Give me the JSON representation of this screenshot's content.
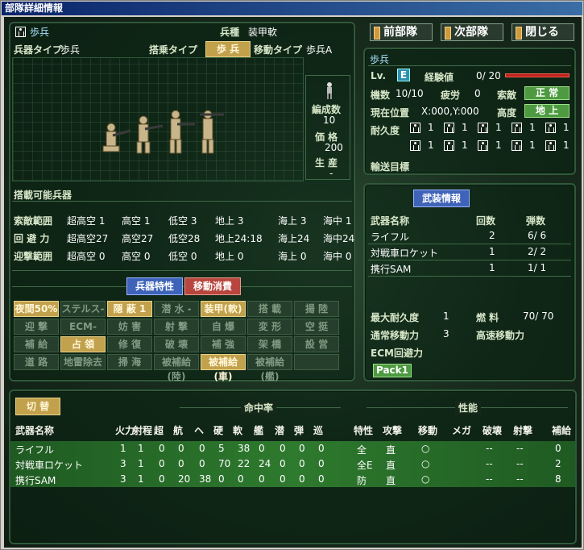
{
  "window": {
    "title": "部隊詳細情報"
  },
  "top_buttons": {
    "prev": "前部隊",
    "next": "次部隊",
    "close": "閉じる"
  },
  "unit": {
    "name": "歩兵",
    "type_label": "兵種",
    "type_value": "装甲軟",
    "weapon_type_label": "兵器タイプ",
    "weapon_type_value": "歩兵",
    "ride_label": "搭乗タイプ",
    "ride_value": "歩 兵",
    "move_type_label": "移動タイプ",
    "move_type_value": "歩兵A",
    "formation_label": "編成数",
    "formation_value": "10",
    "price_label": "価 格",
    "price_value": "200",
    "production_label": "生 産",
    "production_value": "-",
    "carry_label": "搭載可能兵器"
  },
  "ranges": {
    "rows": [
      {
        "label": "索敵範囲",
        "cols": [
          "超高空 1",
          "高空 1",
          "低空 3",
          "地上 3",
          "海上 3",
          "海中 1"
        ]
      },
      {
        "label": "回 避 力",
        "cols": [
          "超高空27",
          "高空27",
          "低空28",
          "地上24:18",
          "海上24",
          "海中24"
        ]
      },
      {
        "label": "迎撃範囲",
        "cols": [
          "超高空 0",
          "高空 0",
          "低空 0",
          "地上 0",
          "海上 0",
          "海中 0"
        ]
      }
    ]
  },
  "tabs": {
    "traits": "兵器特性",
    "move_cost": "移動消費"
  },
  "traits_grid": [
    [
      "夜間50%",
      "ステルス-",
      "隠 蔽 1",
      "潜 水 -",
      "装甲(軟)",
      "搭 載",
      "揚 陸"
    ],
    [
      "迎 撃",
      "ECM-",
      "妨 害",
      "射 撃",
      "自 爆",
      "変 形",
      "空 挺"
    ],
    [
      "補 給",
      "占 領",
      "修 復",
      "破 壊",
      "補 強",
      "架 橋",
      "設 営"
    ],
    [
      "道 路",
      "地雷除去",
      "掃 海",
      "被補給(陸)",
      "被補給(車)",
      "被補給(艦)",
      ""
    ]
  ],
  "traits_on": {
    "夜間50%": true,
    "隠 蔽 1": true,
    "装甲(軟)": true,
    "占 領": true,
    "被補給(車)": true
  },
  "status": {
    "name": "歩兵",
    "lv_label": "Lv.",
    "lv_value": "E",
    "exp_label": "経験値",
    "exp_value": "0/ 20",
    "unit_num_label": "機数",
    "unit_num_value": "10/10",
    "fatigue_label": "疲労",
    "fatigue_value": "0",
    "search_label": "索敵",
    "search_value": "正 常",
    "pos_label": "現在位置",
    "pos_value": "X:000,Y:000",
    "alt_label": "高度",
    "alt_value": "地 上",
    "dur_label": "耐久度",
    "dur_cells": [
      "1",
      "1",
      "1",
      "1",
      "1",
      "1",
      "1",
      "1",
      "1",
      "1"
    ],
    "transport_label": "輸送目標"
  },
  "armament": {
    "title": "武装情報",
    "headers": {
      "name": "武器名称",
      "count": "回数",
      "ammo": "弾数"
    },
    "rows": [
      {
        "name": "ライフル",
        "count": "2",
        "ammo": "6/ 6"
      },
      {
        "name": "対戦車ロケット",
        "count": "1",
        "ammo": "2/ 2"
      },
      {
        "name": "携行SAM",
        "count": "1",
        "ammo": "1/ 1"
      }
    ],
    "max_dur_label": "最大耐久度",
    "max_dur_value": "1",
    "fuel_label": "燃 料",
    "fuel_value": "70/ 70",
    "normal_move_label": "通常移動力",
    "normal_move_value": "3",
    "fast_move_label": "高速移動力",
    "ecm_label": "ECM回避力",
    "pack_label": "Pack1"
  },
  "weapons_table": {
    "switch_label": "切 替",
    "hit_group": "命中率",
    "perf_group": "性能",
    "headers": [
      "武器名称",
      "火力",
      "射程",
      "超",
      "航",
      "ヘ",
      "硬",
      "軟",
      "艦",
      "潜",
      "弾",
      "巡",
      "特性",
      "攻撃",
      "移動",
      "メガ",
      "破壊",
      "射撃",
      "補給"
    ],
    "rows": [
      [
        "ライフル",
        "1",
        "1",
        "0",
        "0",
        "0",
        "5",
        "38",
        "0",
        "0",
        "0",
        "0",
        "全",
        "直",
        "○",
        "",
        "--",
        "--",
        "0"
      ],
      [
        "対戦車ロケット",
        "3",
        "1",
        "0",
        "0",
        "0",
        "70",
        "22",
        "24",
        "0",
        "0",
        "0",
        "全E",
        "直",
        "○",
        "",
        "--",
        "--",
        "2"
      ],
      [
        "携行SAM",
        "3",
        "1",
        "0",
        "20",
        "38",
        "0",
        "0",
        "0",
        "0",
        "0",
        "0",
        "防",
        "直",
        "○",
        "",
        "--",
        "--",
        "8"
      ]
    ]
  }
}
